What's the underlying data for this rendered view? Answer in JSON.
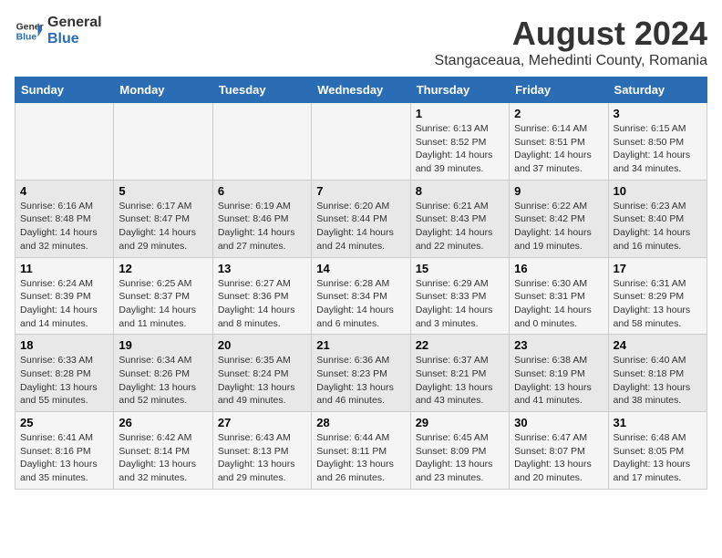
{
  "logo": {
    "general": "General",
    "blue": "Blue"
  },
  "title": "August 2024",
  "subtitle": "Stangaceaua, Mehedinti County, Romania",
  "days_of_week": [
    "Sunday",
    "Monday",
    "Tuesday",
    "Wednesday",
    "Thursday",
    "Friday",
    "Saturday"
  ],
  "weeks": [
    [
      {
        "day": "",
        "info": ""
      },
      {
        "day": "",
        "info": ""
      },
      {
        "day": "",
        "info": ""
      },
      {
        "day": "",
        "info": ""
      },
      {
        "day": "1",
        "info": "Sunrise: 6:13 AM\nSunset: 8:52 PM\nDaylight: 14 hours\nand 39 minutes."
      },
      {
        "day": "2",
        "info": "Sunrise: 6:14 AM\nSunset: 8:51 PM\nDaylight: 14 hours\nand 37 minutes."
      },
      {
        "day": "3",
        "info": "Sunrise: 6:15 AM\nSunset: 8:50 PM\nDaylight: 14 hours\nand 34 minutes."
      }
    ],
    [
      {
        "day": "4",
        "info": "Sunrise: 6:16 AM\nSunset: 8:48 PM\nDaylight: 14 hours\nand 32 minutes."
      },
      {
        "day": "5",
        "info": "Sunrise: 6:17 AM\nSunset: 8:47 PM\nDaylight: 14 hours\nand 29 minutes."
      },
      {
        "day": "6",
        "info": "Sunrise: 6:19 AM\nSunset: 8:46 PM\nDaylight: 14 hours\nand 27 minutes."
      },
      {
        "day": "7",
        "info": "Sunrise: 6:20 AM\nSunset: 8:44 PM\nDaylight: 14 hours\nand 24 minutes."
      },
      {
        "day": "8",
        "info": "Sunrise: 6:21 AM\nSunset: 8:43 PM\nDaylight: 14 hours\nand 22 minutes."
      },
      {
        "day": "9",
        "info": "Sunrise: 6:22 AM\nSunset: 8:42 PM\nDaylight: 14 hours\nand 19 minutes."
      },
      {
        "day": "10",
        "info": "Sunrise: 6:23 AM\nSunset: 8:40 PM\nDaylight: 14 hours\nand 16 minutes."
      }
    ],
    [
      {
        "day": "11",
        "info": "Sunrise: 6:24 AM\nSunset: 8:39 PM\nDaylight: 14 hours\nand 14 minutes."
      },
      {
        "day": "12",
        "info": "Sunrise: 6:25 AM\nSunset: 8:37 PM\nDaylight: 14 hours\nand 11 minutes."
      },
      {
        "day": "13",
        "info": "Sunrise: 6:27 AM\nSunset: 8:36 PM\nDaylight: 14 hours\nand 8 minutes."
      },
      {
        "day": "14",
        "info": "Sunrise: 6:28 AM\nSunset: 8:34 PM\nDaylight: 14 hours\nand 6 minutes."
      },
      {
        "day": "15",
        "info": "Sunrise: 6:29 AM\nSunset: 8:33 PM\nDaylight: 14 hours\nand 3 minutes."
      },
      {
        "day": "16",
        "info": "Sunrise: 6:30 AM\nSunset: 8:31 PM\nDaylight: 14 hours\nand 0 minutes."
      },
      {
        "day": "17",
        "info": "Sunrise: 6:31 AM\nSunset: 8:29 PM\nDaylight: 13 hours\nand 58 minutes."
      }
    ],
    [
      {
        "day": "18",
        "info": "Sunrise: 6:33 AM\nSunset: 8:28 PM\nDaylight: 13 hours\nand 55 minutes."
      },
      {
        "day": "19",
        "info": "Sunrise: 6:34 AM\nSunset: 8:26 PM\nDaylight: 13 hours\nand 52 minutes."
      },
      {
        "day": "20",
        "info": "Sunrise: 6:35 AM\nSunset: 8:24 PM\nDaylight: 13 hours\nand 49 minutes."
      },
      {
        "day": "21",
        "info": "Sunrise: 6:36 AM\nSunset: 8:23 PM\nDaylight: 13 hours\nand 46 minutes."
      },
      {
        "day": "22",
        "info": "Sunrise: 6:37 AM\nSunset: 8:21 PM\nDaylight: 13 hours\nand 43 minutes."
      },
      {
        "day": "23",
        "info": "Sunrise: 6:38 AM\nSunset: 8:19 PM\nDaylight: 13 hours\nand 41 minutes."
      },
      {
        "day": "24",
        "info": "Sunrise: 6:40 AM\nSunset: 8:18 PM\nDaylight: 13 hours\nand 38 minutes."
      }
    ],
    [
      {
        "day": "25",
        "info": "Sunrise: 6:41 AM\nSunset: 8:16 PM\nDaylight: 13 hours\nand 35 minutes."
      },
      {
        "day": "26",
        "info": "Sunrise: 6:42 AM\nSunset: 8:14 PM\nDaylight: 13 hours\nand 32 minutes."
      },
      {
        "day": "27",
        "info": "Sunrise: 6:43 AM\nSunset: 8:13 PM\nDaylight: 13 hours\nand 29 minutes."
      },
      {
        "day": "28",
        "info": "Sunrise: 6:44 AM\nSunset: 8:11 PM\nDaylight: 13 hours\nand 26 minutes."
      },
      {
        "day": "29",
        "info": "Sunrise: 6:45 AM\nSunset: 8:09 PM\nDaylight: 13 hours\nand 23 minutes."
      },
      {
        "day": "30",
        "info": "Sunrise: 6:47 AM\nSunset: 8:07 PM\nDaylight: 13 hours\nand 20 minutes."
      },
      {
        "day": "31",
        "info": "Sunrise: 6:48 AM\nSunset: 8:05 PM\nDaylight: 13 hours\nand 17 minutes."
      }
    ]
  ]
}
